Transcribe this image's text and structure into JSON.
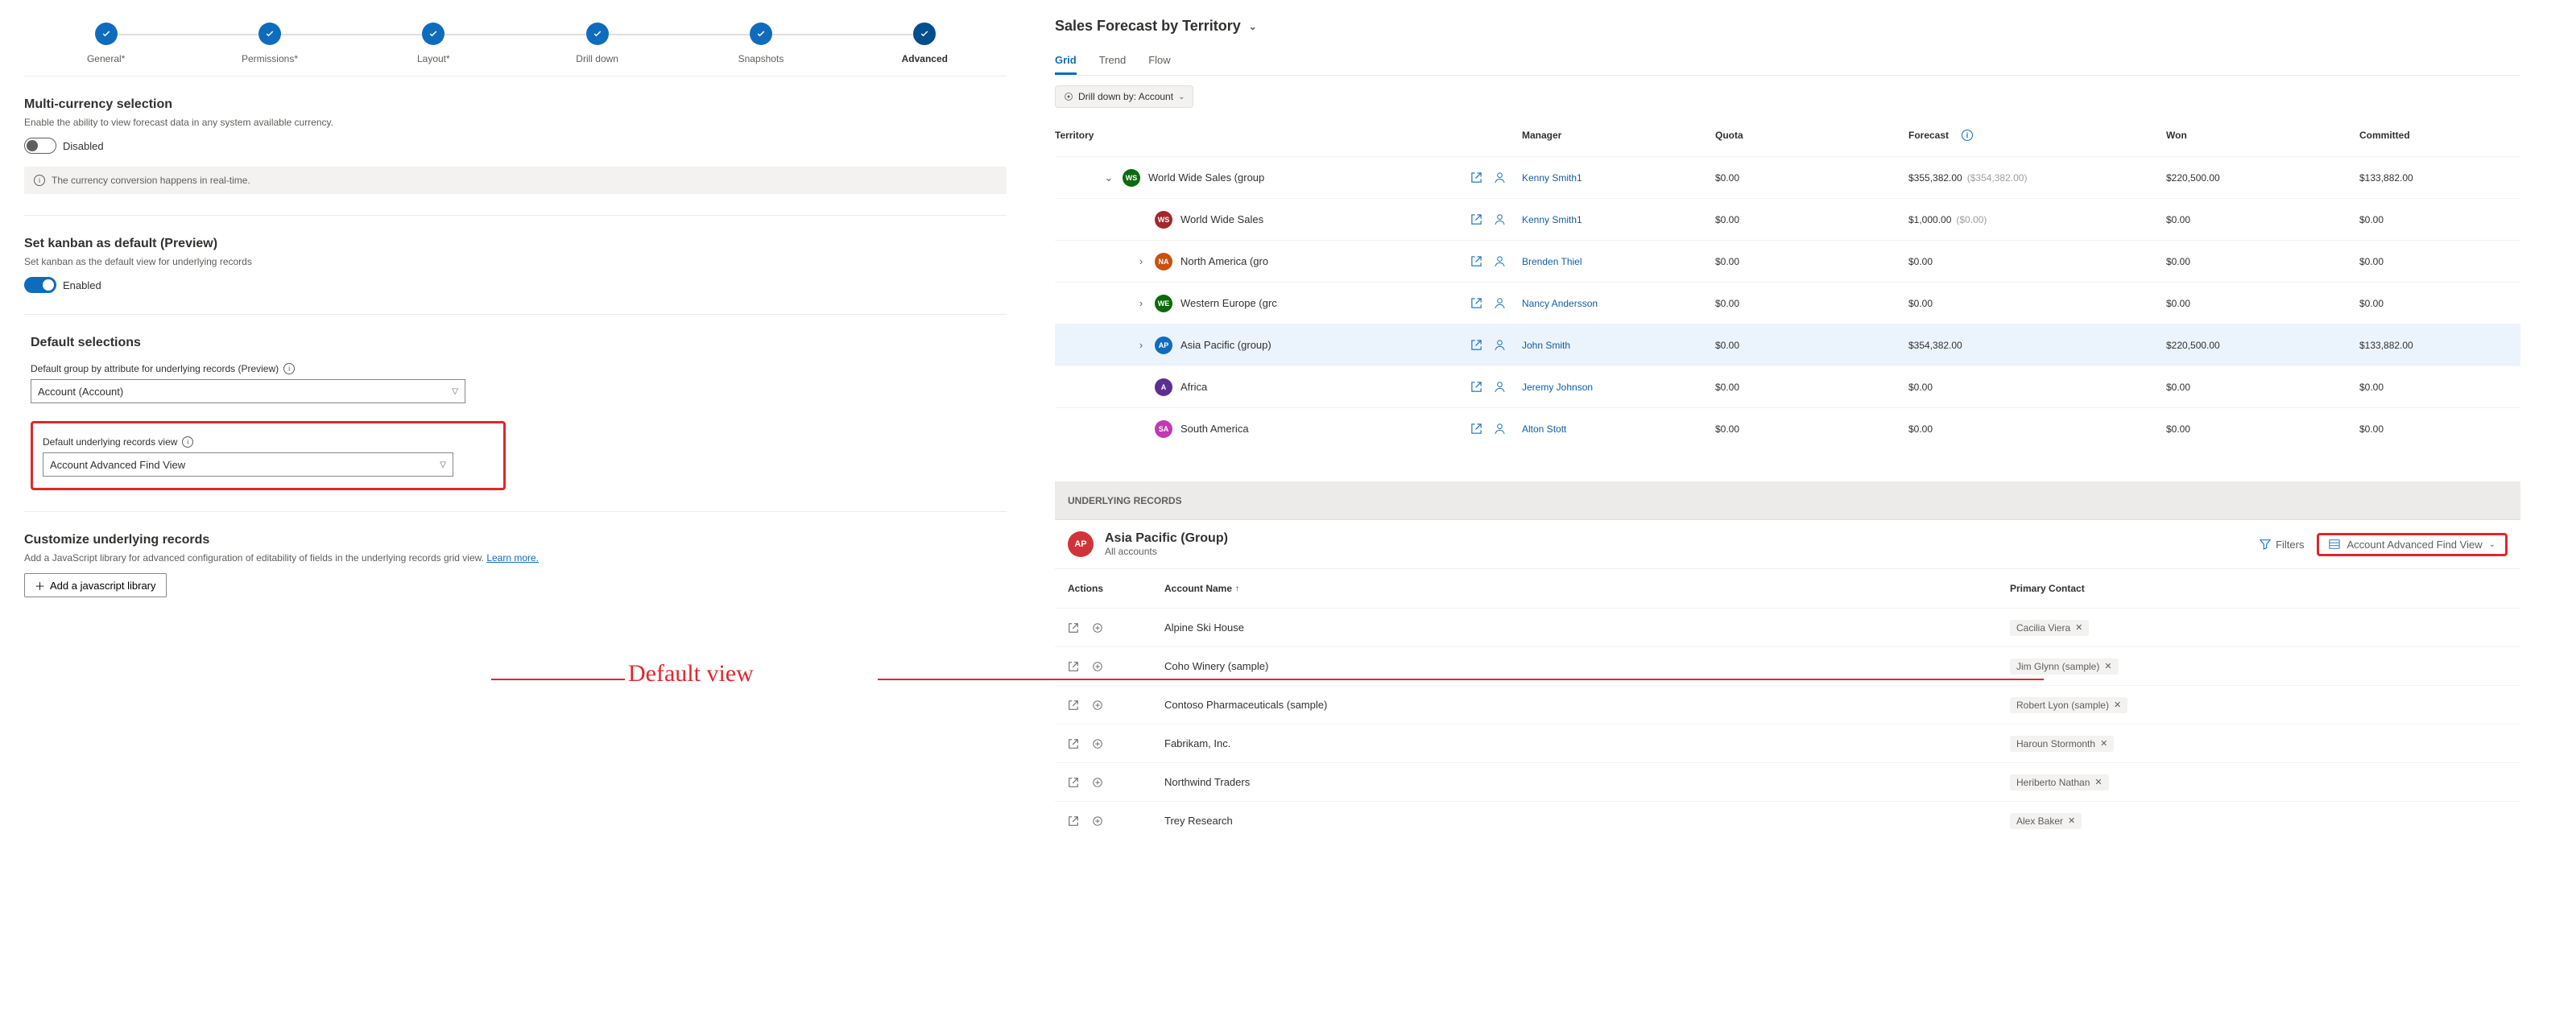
{
  "stepper": {
    "steps": [
      {
        "label": "General*"
      },
      {
        "label": "Permissions*"
      },
      {
        "label": "Layout*"
      },
      {
        "label": "Drill down"
      },
      {
        "label": "Snapshots"
      },
      {
        "label": "Advanced"
      }
    ]
  },
  "multi_currency": {
    "title": "Multi-currency selection",
    "desc": "Enable the ability to view forecast data in any system available currency.",
    "toggle_label": "Disabled",
    "info_text": "The currency conversion happens in real-time."
  },
  "kanban": {
    "title": "Set kanban as default (Preview)",
    "desc": "Set kanban as the default view for underlying records",
    "toggle_label": "Enabled"
  },
  "default_selections": {
    "title": "Default selections",
    "group_label": "Default group by attribute for underlying records (Preview)",
    "group_value": "Account (Account)",
    "view_label": "Default underlying records view",
    "view_value": "Account Advanced Find View"
  },
  "customize": {
    "title": "Customize underlying records",
    "desc_pre": "Add a JavaScript library for advanced configuration of editability of fields in the underlying records grid view. ",
    "learn_more": "Learn more.",
    "button_label": "Add a javascript library"
  },
  "right": {
    "title": "Sales Forecast by Territory",
    "tabs": {
      "grid": "Grid",
      "trend": "Trend",
      "flow": "Flow"
    },
    "drill_chip": "Drill down by: Account",
    "columns": {
      "territory": "Territory",
      "manager": "Manager",
      "quota": "Quota",
      "forecast": "Forecast",
      "won": "Won",
      "committed": "Committed"
    },
    "rows": [
      {
        "indent": 1,
        "exp": "down",
        "badge": "WS",
        "bcolor": "#0b6a0b",
        "name": "World Wide Sales (group",
        "mgr": "Kenny Smith1",
        "quota": "$0.00",
        "forecast": "$355,382.00",
        "fsec": "($354,382.00)",
        "won": "$220,500.00",
        "committed": "$133,882.00"
      },
      {
        "indent": 2,
        "exp": "",
        "badge": "WS",
        "bcolor": "#a4262c",
        "name": "World Wide Sales",
        "mgr": "Kenny Smith1",
        "quota": "$0.00",
        "forecast": "$1,000.00",
        "fsec": "($0.00)",
        "won": "$0.00",
        "committed": "$0.00"
      },
      {
        "indent": 2,
        "exp": "right",
        "badge": "NA",
        "bcolor": "#ca5010",
        "name": "North America (gro",
        "mgr": "Brenden Thiel",
        "quota": "$0.00",
        "forecast": "$0.00",
        "fsec": "",
        "won": "$0.00",
        "committed": "$0.00"
      },
      {
        "indent": 2,
        "exp": "right",
        "badge": "WE",
        "bcolor": "#0b6a0b",
        "name": "Western Europe (grc",
        "mgr": "Nancy Andersson",
        "quota": "$0.00",
        "forecast": "$0.00",
        "fsec": "",
        "won": "$0.00",
        "committed": "$0.00"
      },
      {
        "indent": 2,
        "exp": "right",
        "badge": "AP",
        "bcolor": "#0F6CBD",
        "name": "Asia Pacific (group)",
        "mgr": "John Smith",
        "quota": "$0.00",
        "forecast": "$354,382.00",
        "fsec": "",
        "won": "$220,500.00",
        "committed": "$133,882.00",
        "selected": true
      },
      {
        "indent": 2,
        "exp": "",
        "badge": "A",
        "bcolor": "#5c2e91",
        "name": "Africa",
        "mgr": "Jeremy Johnson",
        "quota": "$0.00",
        "forecast": "$0.00",
        "fsec": "",
        "won": "$0.00",
        "committed": "$0.00"
      },
      {
        "indent": 2,
        "exp": "",
        "badge": "SA",
        "bcolor": "#c239b3",
        "name": "South America",
        "mgr": "Alton Stott",
        "quota": "$0.00",
        "forecast": "$0.00",
        "fsec": "",
        "won": "$0.00",
        "committed": "$0.00"
      }
    ],
    "ur_label": "UNDERLYING RECORDS",
    "ur_title": "Asia Pacific (Group)",
    "ur_sub": "All accounts",
    "filters_label": "Filters",
    "view_selector": "Account Advanced Find View",
    "ur_columns": {
      "actions": "Actions",
      "account": "Account Name",
      "contact": "Primary Contact"
    },
    "ur_rows": [
      {
        "name": "Alpine Ski House",
        "contact": "Cacilia Viera"
      },
      {
        "name": "Coho Winery (sample)",
        "contact": "Jim Glynn (sample)"
      },
      {
        "name": "Contoso Pharmaceuticals (sample)",
        "contact": "Robert Lyon (sample)"
      },
      {
        "name": "Fabrikam, Inc.",
        "contact": "Haroun Stormonth"
      },
      {
        "name": "Northwind Traders",
        "contact": "Heriberto Nathan"
      },
      {
        "name": "Trey Research",
        "contact": "Alex Baker"
      }
    ]
  },
  "annotation": {
    "text": "Default view"
  }
}
